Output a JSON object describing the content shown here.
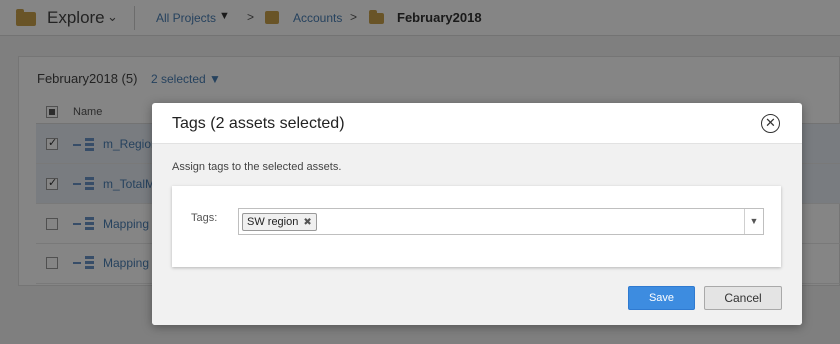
{
  "topbar": {
    "explore_label": "Explore",
    "breadcrumb": {
      "all_projects": "All Projects",
      "accounts": "Accounts",
      "current": "February2018",
      "separator": ">"
    }
  },
  "panel": {
    "title": "February2018 (5)",
    "selected_label": "2 selected ▼",
    "column_name": "Name",
    "rows": [
      {
        "name": "m_Region",
        "selected": true
      },
      {
        "name": "m_TotalM",
        "selected": true
      },
      {
        "name": "Mapping",
        "selected": false
      },
      {
        "name": "Mapping",
        "selected": false
      }
    ]
  },
  "dialog": {
    "title": "Tags (2 assets selected)",
    "instruction": "Assign tags to the selected assets.",
    "tags_label": "Tags:",
    "tags": [
      "SW region"
    ],
    "save_label": "Save",
    "cancel_label": "Cancel"
  },
  "colors": {
    "accent": "#3d8ce0",
    "link": "#4a7fb5",
    "folder": "#c9a24c"
  }
}
